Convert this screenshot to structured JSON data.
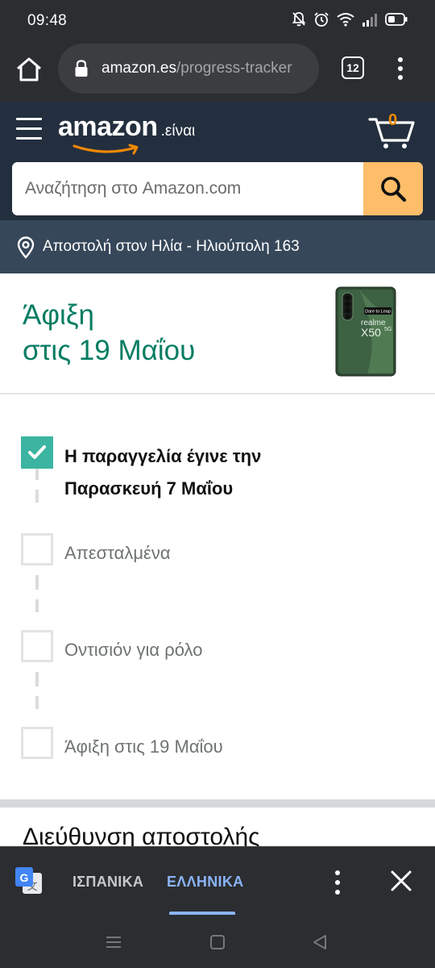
{
  "status_bar": {
    "time": "09:48",
    "icons": [
      "bell-off-icon",
      "alarm-icon",
      "wifi-icon",
      "signal-icon",
      "battery-icon"
    ]
  },
  "browser": {
    "url_domain": "amazon.es",
    "url_path": "/progress-tracker",
    "tab_count": "12",
    "icons": [
      "home-icon",
      "lock-icon",
      "more-vert-icon"
    ]
  },
  "amazon_header": {
    "logo_word": "amazon",
    "logo_suffix": ".είναι",
    "cart_count": "0",
    "search_placeholder": "Αναζήτηση στο Amazon.com",
    "accent_color": "#febd69",
    "header_color": "#232f3e"
  },
  "delivery": {
    "text": "Αποστολή στον Ηλία - Ηλιούπολη 163"
  },
  "arrival": {
    "line1": "Άφιξη",
    "line2": "στις 19 Μαΐου",
    "title_color": "#067d62",
    "product_image_text": {
      "badge": "Dare to Leap",
      "brand": "realme",
      "model": "X50",
      "suffix": "5G"
    }
  },
  "tracker": {
    "steps": [
      {
        "line1": "Η παραγγελία έγινε την",
        "line2": "Παρασκευή 7 Μαΐου",
        "checked": true
      },
      {
        "line1": "Απεσταλμένα",
        "checked": false
      },
      {
        "line1": "Οντισιόν για ρόλο",
        "checked": false
      },
      {
        "line1": "Άφιξη στις 19 Μαΐου",
        "checked": false
      }
    ],
    "check_color": "#3bb5a1"
  },
  "shipping_section": {
    "title": "Διεύθυνση αποστολής"
  },
  "translate_bar": {
    "source_lang": "ΙΣΠΑΝΙΚΑ",
    "target_lang": "ΕΛΛΗΝΙΚΑ",
    "active_color": "#8ab4f8",
    "icons": [
      "google-translate-icon",
      "more-vert-icon",
      "close-icon"
    ]
  },
  "nav_bar": {
    "icons": [
      "recents-icon",
      "home-icon",
      "back-icon"
    ]
  }
}
